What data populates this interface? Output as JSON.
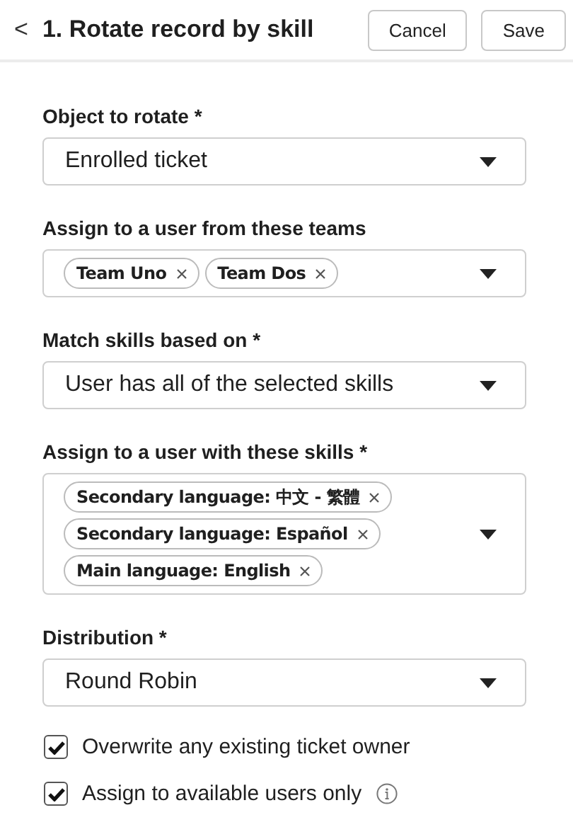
{
  "header": {
    "back": "<",
    "title": "1. Rotate record by skill",
    "buttons": [
      "Cancel",
      "Save"
    ]
  },
  "fields": [
    {
      "kind": "select",
      "label": "Object to rotate *",
      "value": "Enrolled ticket"
    },
    {
      "kind": "tags",
      "label": "Assign to a user from these teams",
      "tags": [
        "Team Uno",
        "Team Dos"
      ]
    },
    {
      "kind": "select",
      "label": "Match skills based on *",
      "value": "User has all of the selected skills"
    },
    {
      "kind": "tags",
      "label": "Assign to a user with these skills *",
      "tags": [
        "Secondary language: 中文 - 繁體",
        "Secondary language: Español",
        "Main language: English"
      ]
    },
    {
      "kind": "select",
      "label": "Distribution *",
      "value": "Round Robin"
    }
  ],
  "checkboxes": [
    {
      "label": "Overwrite any existing ticket owner",
      "checked": true,
      "info": false
    },
    {
      "label": "Assign to available users only",
      "checked": true,
      "info": true
    }
  ]
}
